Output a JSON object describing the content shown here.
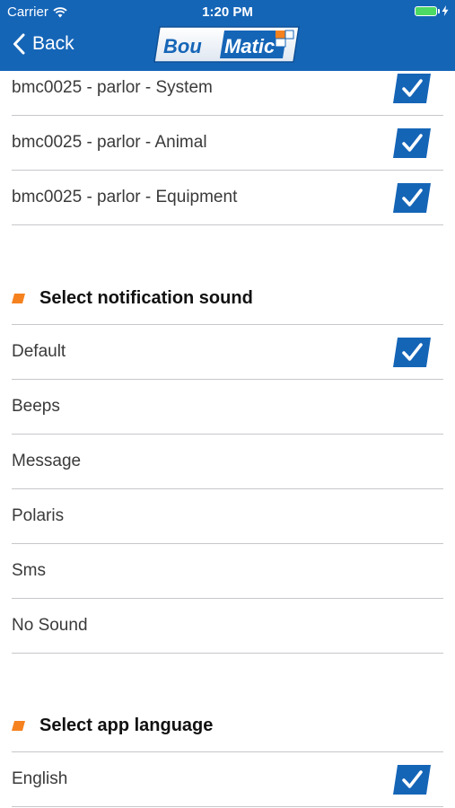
{
  "status_bar": {
    "carrier": "Carrier",
    "time": "1:20 PM"
  },
  "nav": {
    "back_label": "Back",
    "logo_text_left": "Bou",
    "logo_text_right": "Matic"
  },
  "colors": {
    "nav_background": "#1565b7",
    "checkbox": "#1565b7",
    "accent_orange": "#f5821f"
  },
  "icons": {
    "back": "chevron-left",
    "checked": "checkmark",
    "section_bullet": "orange-parallelogram"
  },
  "alert_rows": [
    {
      "label": "bmc0025 - parlor - System",
      "checked": true
    },
    {
      "label": "bmc0025 - parlor - Animal",
      "checked": true
    },
    {
      "label": "bmc0025 - parlor - Equipment",
      "checked": true
    }
  ],
  "sound_section": {
    "title": "Select notification sound",
    "options": [
      {
        "label": "Default",
        "selected": true
      },
      {
        "label": "Beeps",
        "selected": false
      },
      {
        "label": "Message",
        "selected": false
      },
      {
        "label": "Polaris",
        "selected": false
      },
      {
        "label": "Sms",
        "selected": false
      },
      {
        "label": "No Sound",
        "selected": false
      }
    ]
  },
  "language_section": {
    "title": "Select app language",
    "options": [
      {
        "label": "English",
        "selected": true
      }
    ]
  }
}
